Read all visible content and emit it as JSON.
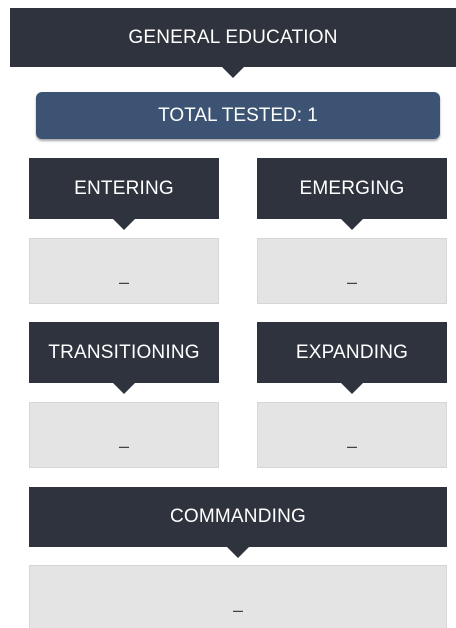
{
  "header": {
    "title": "GENERAL EDUCATION"
  },
  "summary": {
    "total_tested": "TOTAL TESTED: 1"
  },
  "levels": [
    {
      "label": "ENTERING",
      "value": "–"
    },
    {
      "label": "EMERGING",
      "value": "–"
    },
    {
      "label": "TRANSITIONING",
      "value": "–"
    },
    {
      "label": "EXPANDING",
      "value": "–"
    },
    {
      "label": "COMMANDING",
      "value": "–"
    }
  ],
  "colors": {
    "banner": "#2f333d",
    "total": "#3c5373",
    "value_box": "#e4e4e4"
  }
}
